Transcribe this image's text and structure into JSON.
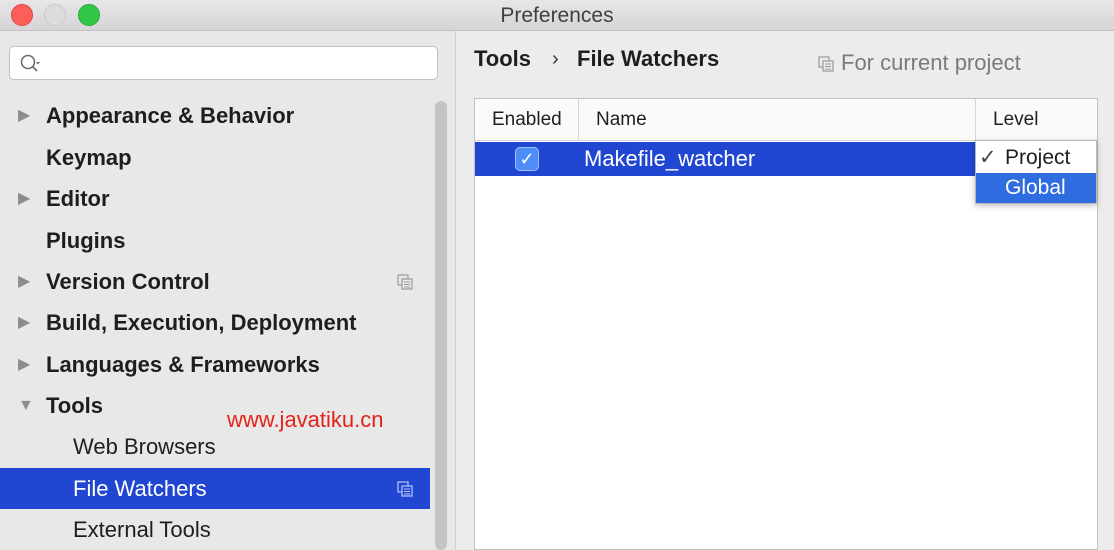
{
  "window": {
    "title": "Preferences"
  },
  "search": {
    "placeholder": ""
  },
  "sidebar": {
    "items": [
      {
        "label": "Appearance & Behavior"
      },
      {
        "label": "Keymap"
      },
      {
        "label": "Editor"
      },
      {
        "label": "Plugins"
      },
      {
        "label": "Version Control"
      },
      {
        "label": "Build, Execution, Deployment"
      },
      {
        "label": "Languages & Frameworks"
      },
      {
        "label": "Tools"
      },
      {
        "label": "Web Browsers"
      },
      {
        "label": "File Watchers"
      },
      {
        "label": "External Tools"
      }
    ]
  },
  "watermark": "www.javatiku.cn",
  "breadcrumb": {
    "parent": "Tools",
    "separator": "›",
    "current": "File Watchers",
    "scope": "For current project"
  },
  "table": {
    "columns": [
      "Enabled",
      "Name",
      "Level"
    ],
    "rows": [
      {
        "enabled": "✓",
        "name": "Makefile_watcher"
      }
    ]
  },
  "level_dropdown": {
    "options": [
      {
        "label": "Project",
        "check": "✓"
      },
      {
        "label": "Global"
      }
    ]
  },
  "colors": {
    "selection": "#2146d2",
    "highlight": "#2f6ce0",
    "watermark": "#e2231a"
  }
}
